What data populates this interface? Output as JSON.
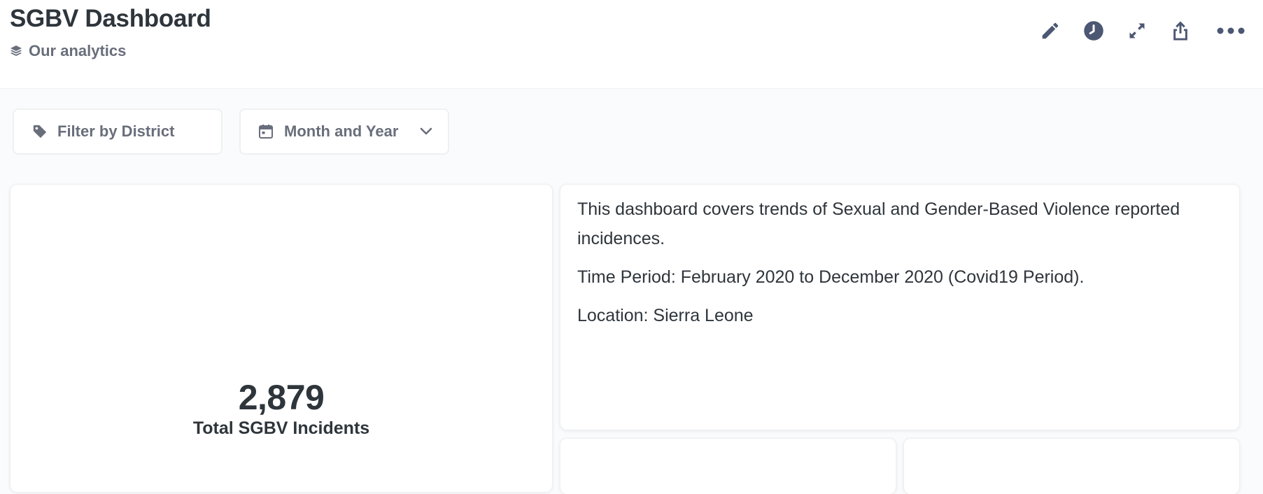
{
  "dashboard": {
    "title": "SGBV Dashboard",
    "collection": {
      "icon": "collection-icon",
      "label": "Our analytics"
    }
  },
  "header_actions": [
    {
      "name": "edit",
      "icon": "pencil-icon"
    },
    {
      "name": "history",
      "icon": "clock-icon"
    },
    {
      "name": "fullscreen",
      "icon": "expand-icon"
    },
    {
      "name": "share",
      "icon": "share-icon"
    },
    {
      "name": "more",
      "icon": "more-horizontal-icon"
    }
  ],
  "filters": {
    "district": {
      "label": "Filter by District",
      "icon": "tag-icon"
    },
    "date": {
      "label": "Month and Year",
      "icon": "calendar-icon",
      "dropdown_icon": "chevron-down-icon"
    }
  },
  "cards": {
    "metric": {
      "value": "2,879",
      "label": "Total SGBV Incidents"
    },
    "text": {
      "paragraphs": [
        "This dashboard covers trends of Sexual and Gender-Based Violence reported incidences.",
        "Time Period: February 2020 to December 2020 (Covid19 Period).",
        "Location: Sierra Leone"
      ]
    }
  },
  "colors": {
    "title": "#2e353b",
    "muted": "#696e7b",
    "icon": "#4c5773",
    "background": "#f9fbfc",
    "card": "#ffffff",
    "border": "#eef0f2"
  }
}
